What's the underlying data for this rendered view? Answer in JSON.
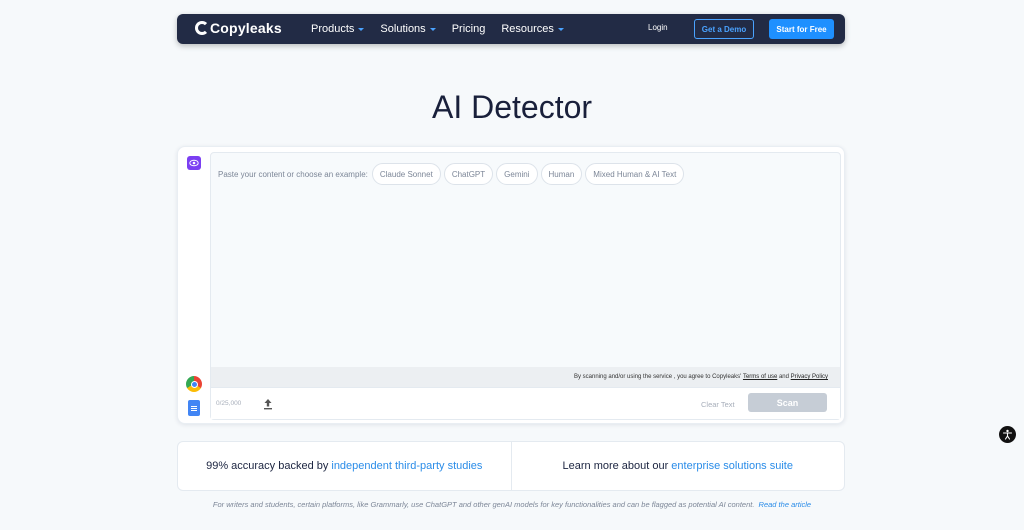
{
  "nav": {
    "logo": "Copyleaks",
    "links": [
      {
        "label": "Products",
        "dropdown": true
      },
      {
        "label": "Solutions",
        "dropdown": true
      },
      {
        "label": "Pricing",
        "dropdown": false
      },
      {
        "label": "Resources",
        "dropdown": true
      }
    ],
    "login": "Login",
    "demo": "Get a Demo",
    "start": "Start for Free"
  },
  "page_title": "AI Detector",
  "editor": {
    "prompt": "Paste your content or choose an example:",
    "examples": [
      "Claude Sonnet",
      "ChatGPT",
      "Gemini",
      "Human",
      "Mixed Human & AI Text"
    ],
    "terms_prefix": "By scanning and/or using the service , you agree to Copyleaks'",
    "terms_link": "Terms of use",
    "terms_and": "and",
    "privacy_link": "Privacy Policy",
    "counter": "0/25,000",
    "clear": "Clear Text",
    "scan": "Scan"
  },
  "info": {
    "left_text": "99% accuracy backed by",
    "left_link": "independent third-party studies",
    "right_text": "Learn more about our",
    "right_link": "enterprise solutions suite"
  },
  "footnote": {
    "text": "For writers and students, certain platforms, like Grammarly, use ChatGPT and other genAI models for key functionalities and can be flagged as potential AI content.",
    "link": "Read the article"
  },
  "colors": {
    "nav_bg": "#222b45",
    "accent": "#1e90ff",
    "link": "#2a8ce8",
    "scan_disabled": "#c6cdd6",
    "eye_purple": "#7b3ff2"
  }
}
